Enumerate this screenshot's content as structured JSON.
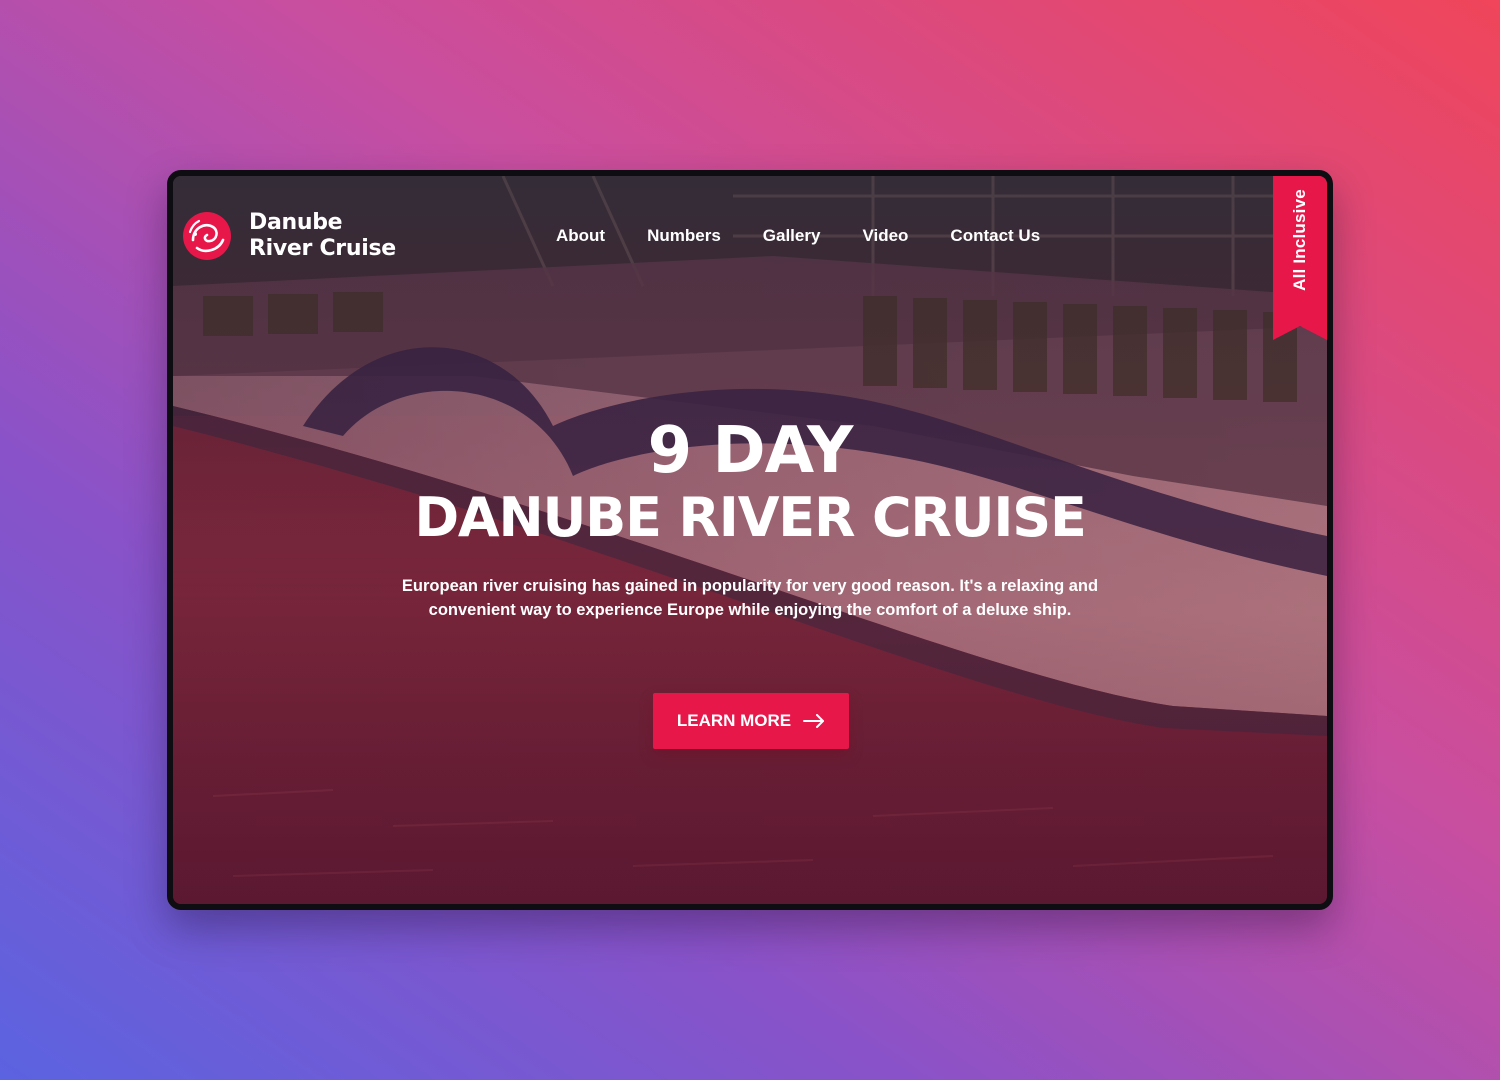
{
  "brand": {
    "name": "Danube River Cruise",
    "logo_icon": "swirl-globe-icon"
  },
  "nav": {
    "items": [
      {
        "label": "About"
      },
      {
        "label": "Numbers"
      },
      {
        "label": "Gallery"
      },
      {
        "label": "Video"
      },
      {
        "label": "Contact Us"
      }
    ]
  },
  "ribbon": {
    "label": "All Inclusive"
  },
  "hero": {
    "title_top": "9 DAY",
    "title_main": "DANUBE RIVER CRUISE",
    "description": "European river cruising has gained in popularity for very good reason. It's a relaxing and convenient way to experience Europe while enjoying the comfort of a deluxe ship.",
    "cta_label": "LEARN MORE",
    "cta_icon": "arrow-right-icon",
    "background_image": "river-cruise-ship-photo"
  },
  "colors": {
    "accent": "#e8174a",
    "text": "#ffffff"
  }
}
